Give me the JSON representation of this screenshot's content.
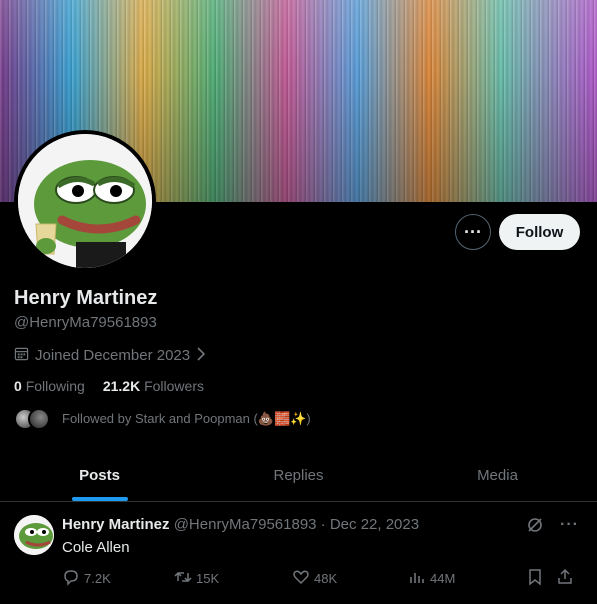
{
  "profile": {
    "name": "Henry Martinez",
    "handle": "@HenryMa79561893",
    "joined": "Joined December 2023",
    "following_count": "0",
    "following_label": "Following",
    "followers_count": "21.2K",
    "followers_label": "Followers",
    "followed_by": "Followed by Stark and Poopman (💩🧱✨)"
  },
  "buttons": {
    "follow": "Follow",
    "more": "···"
  },
  "tabs": [
    "Posts",
    "Replies",
    "Media"
  ],
  "tweet": {
    "name": "Henry Martinez",
    "meta": "@HenryMa79561893 · Dec 22, 2023",
    "text": "Cole Allen",
    "replies": "7.2K",
    "reposts": "15K",
    "likes": "48K",
    "views": "44M"
  },
  "colors": {
    "accent": "#1d9bf0",
    "muted": "#71767b",
    "text": "#e7e9ea"
  }
}
